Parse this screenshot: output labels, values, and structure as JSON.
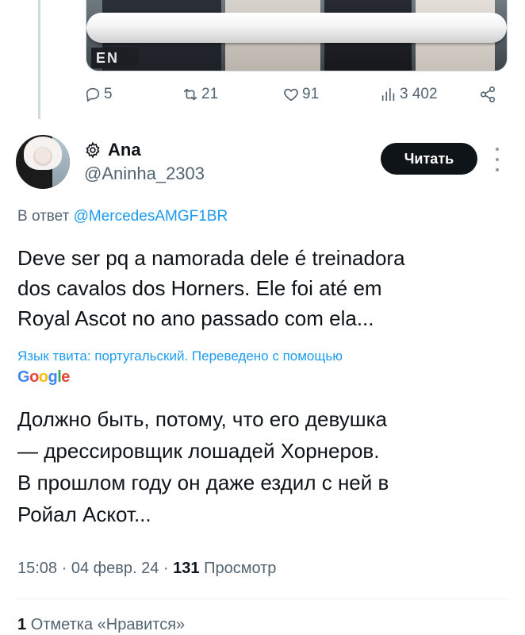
{
  "parent_tweet": {
    "media_sign_text": "EN",
    "actions": {
      "replies": "5",
      "retweets": "21",
      "likes": "91",
      "views": "3 402"
    }
  },
  "tweet": {
    "author": {
      "display_name": "Ana",
      "handle": "@Aninha_2303"
    },
    "follow_label": "Читать",
    "reply_to_prefix": "В ответ",
    "reply_to_handle": "@MercedesAMGF1BR",
    "text": "Deve ser pq a namorada dele é treinadora\ndos cavalos dos Horners. Ele foi até em\nRoyal Ascot no ano passado com ela...",
    "translation_note": "Язык твита: португальский. Переведено с помощью",
    "translation_provider": "Google",
    "translated_text": "Должно быть, потому, что его девушка\n— дрессировщик лошадей Хорнеров.\nВ прошлом году он даже ездил с ней в\nРойал Аскот...",
    "time": "15:08",
    "separator": "·",
    "date": "04 февр. 24",
    "views_count": "131",
    "views_label": "Просмотр",
    "likes_count": "1",
    "likes_label": "Отметка «Нравится»"
  },
  "colors": {
    "accent": "#1d9bf0",
    "text_primary": "#0f1419",
    "text_secondary": "#536471",
    "button_bg": "#0f1419"
  },
  "icons": [
    "reply-icon",
    "retweet-icon",
    "like-icon",
    "views-icon",
    "share-icon",
    "gear-icon",
    "more-icon"
  ]
}
